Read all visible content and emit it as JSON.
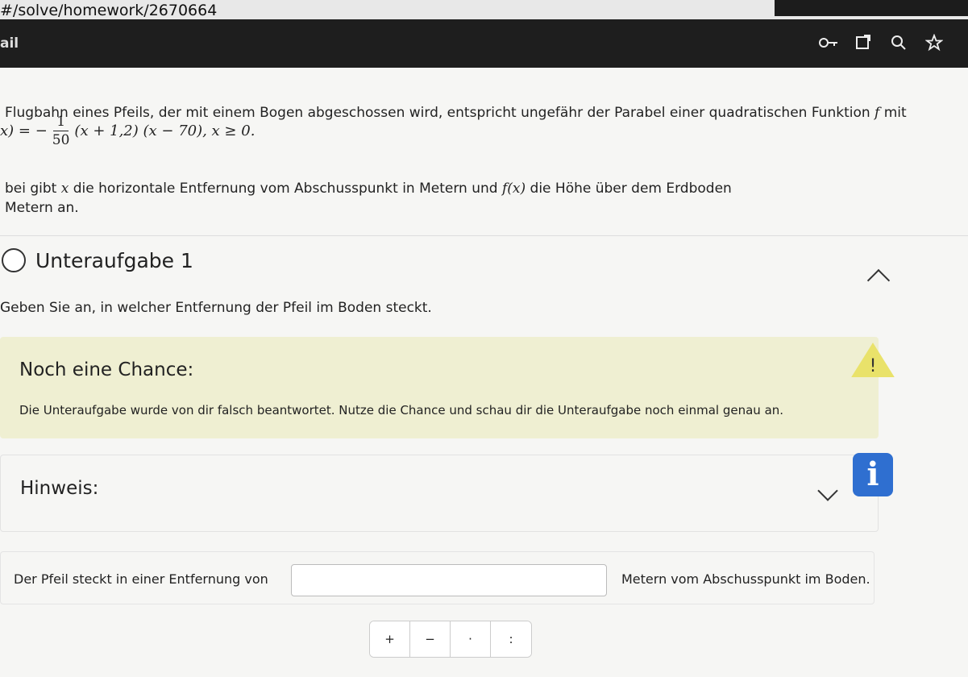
{
  "browser": {
    "url": "#/solve/homework/2670664",
    "toolbar_left_text": "ail",
    "icons": [
      "key-icon",
      "refresh-icon",
      "search-icon",
      "star-icon"
    ]
  },
  "task": {
    "intro_line1": "Flugbahn eines Pfeils, der mit einem Bogen abgeschossen wird, entspricht ungefähr der Parabel einer quadratischen Funktion",
    "intro_var": "f",
    "intro_tail": "mit",
    "formula_left": "x) = −",
    "formula_num": "1",
    "formula_den": "50",
    "formula_right": "(x + 1,2) (x − 70), x ≥ 0.",
    "desc_line1_a": "bei gibt",
    "desc_line1_var": "x",
    "desc_line1_b": "die horizontale Entfernung vom Abschusspunkt in Metern und",
    "desc_line1_func": "f(x)",
    "desc_line1_c": "die Höhe über dem Erdboden",
    "desc_line2": "Metern an."
  },
  "subtask": {
    "title": "Unteraufgabe 1",
    "question": "Geben Sie an, in welcher Entfernung der Pfeil im Boden steckt."
  },
  "chance": {
    "title": "Noch eine Chance:",
    "text": "Die Unteraufgabe wurde von dir falsch beantwortet. Nutze die Chance und schau dir die Unteraufgabe noch einmal genau an.",
    "warning_symbol": "!",
    "color": "#efefd2"
  },
  "hint": {
    "title": "Hinweis:",
    "info_symbol": "i",
    "info_color": "#2f6fd0"
  },
  "answer": {
    "prefix": "Der Pfeil steckt in einer Entfernung von",
    "value": "",
    "suffix": "Metern vom Abschusspunkt im Boden."
  },
  "operators": [
    "+",
    "−",
    "·",
    ":"
  ]
}
